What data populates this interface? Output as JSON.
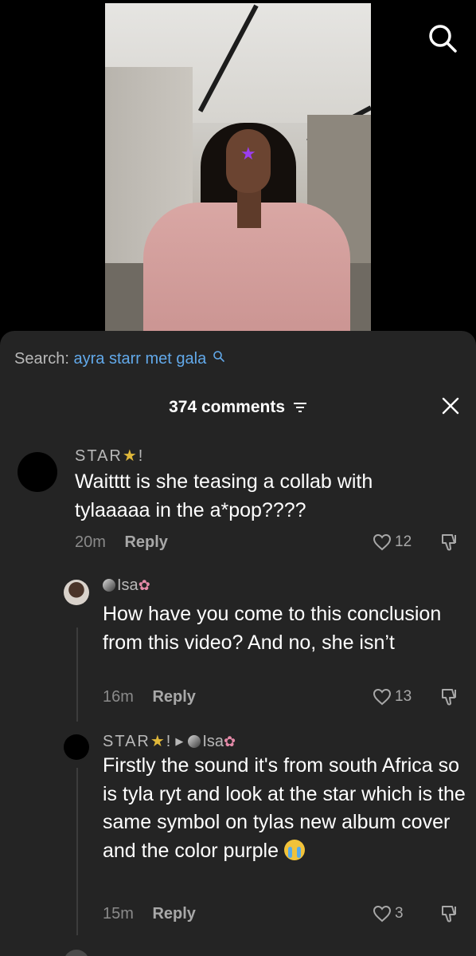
{
  "search": {
    "label": "Search:",
    "query": "ayra starr met gala"
  },
  "comments_header": {
    "count_label": "374 comments"
  },
  "comments": [
    {
      "username": "STAR",
      "text": "Waitttt is she teasing a collab with tylaaaaa in the a*pop????",
      "time": "20m",
      "reply_label": "Reply",
      "likes": "12"
    },
    {
      "username": "Isa",
      "text": "How have you come to this conclusion from this video? And no, she isn’t",
      "time": "16m",
      "reply_label": "Reply",
      "likes": "13"
    },
    {
      "username": "STAR",
      "reply_to": "Isa",
      "text": "Firstly the sound it's from south Africa so is tyla ryt and look at the star which is the same symbol on tylas new album cover and the color purple",
      "time": "15m",
      "reply_label": "Reply",
      "likes": "3"
    }
  ],
  "icons": {
    "top_search": "search-icon",
    "filter": "filter-icon",
    "close": "close-icon",
    "like": "heart-outline-icon",
    "dislike": "dislike-icon"
  },
  "colors": {
    "sheet_bg": "#242424",
    "search_query": "#62a9ea",
    "star_emoji": "#e0b83a",
    "sticker": "#9b3df0"
  }
}
